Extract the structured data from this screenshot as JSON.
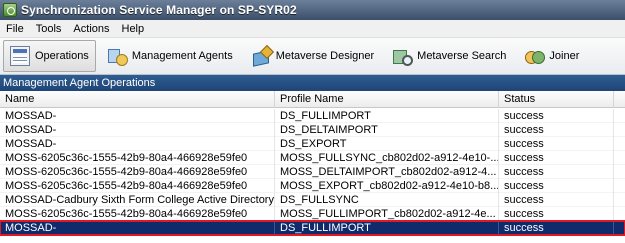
{
  "window": {
    "title": "Synchronization Service Manager on SP-SYR02"
  },
  "menu": [
    "File",
    "Tools",
    "Actions",
    "Help"
  ],
  "toolbar": [
    {
      "label": "Operations",
      "icon": "operations-icon",
      "active": true
    },
    {
      "label": "Management Agents",
      "icon": "management-agents-icon",
      "active": false
    },
    {
      "label": "Metaverse Designer",
      "icon": "metaverse-designer-icon",
      "active": false
    },
    {
      "label": "Metaverse Search",
      "icon": "metaverse-search-icon",
      "active": false
    },
    {
      "label": "Joiner",
      "icon": "joiner-icon",
      "active": false
    }
  ],
  "section": {
    "title": "Management Agent Operations"
  },
  "grid": {
    "columns": [
      "Name",
      "Profile Name",
      "Status"
    ],
    "rows": [
      {
        "name": "MOSSAD-",
        "profile": "DS_FULLIMPORT",
        "status": "success",
        "selected": false
      },
      {
        "name": "MOSSAD-",
        "profile": "DS_DELTAIMPORT",
        "status": "success",
        "selected": false
      },
      {
        "name": "MOSSAD-",
        "profile": "DS_EXPORT",
        "status": "success",
        "selected": false
      },
      {
        "name": "MOSS-6205c36c-1555-42b9-80a4-466928e59fe0",
        "profile": "MOSS_FULLSYNC_cb802d02-a912-4e10-...",
        "status": "success",
        "selected": false
      },
      {
        "name": "MOSS-6205c36c-1555-42b9-80a4-466928e59fe0",
        "profile": "MOSS_DELTAIMPORT_cb802d02-a912-4...",
        "status": "success",
        "selected": false
      },
      {
        "name": "MOSS-6205c36c-1555-42b9-80a4-466928e59fe0",
        "profile": "MOSS_EXPORT_cb802d02-a912-4e10-b8...",
        "status": "success",
        "selected": false
      },
      {
        "name": "MOSSAD-Cadbury Sixth Form College Active Directory",
        "profile": "DS_FULLSYNC",
        "status": "success",
        "selected": false
      },
      {
        "name": "MOSS-6205c36c-1555-42b9-80a4-466928e59fe0",
        "profile": "MOSS_FULLIMPORT_cb802d02-a912-4e...",
        "status": "success",
        "selected": false
      },
      {
        "name": "MOSSAD-",
        "profile": "DS_FULLIMPORT",
        "status": "success",
        "selected": true
      }
    ]
  },
  "colors": {
    "selection": "#0f2b6b",
    "highlight_border": "#e01824",
    "section_header": "#2f5d92"
  }
}
